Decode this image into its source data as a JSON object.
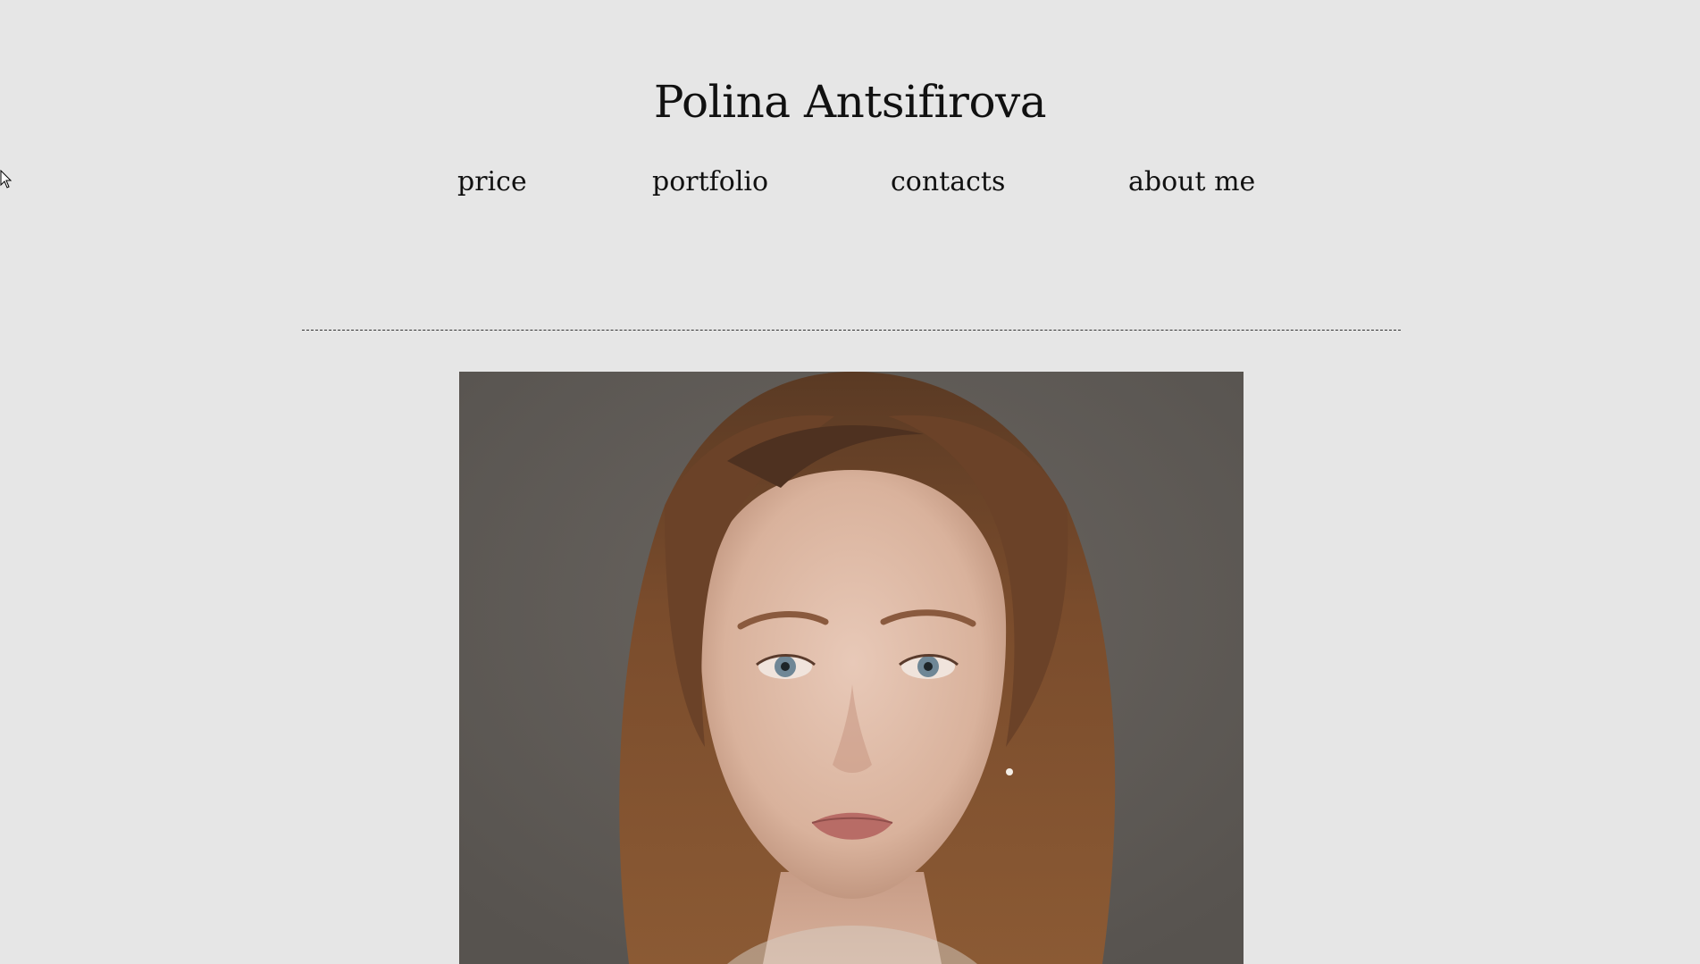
{
  "header": {
    "site_title": "Polina Antsifirova"
  },
  "nav": {
    "items": [
      {
        "label": "price"
      },
      {
        "label": "portfolio"
      },
      {
        "label": "contacts"
      },
      {
        "label": "about me"
      }
    ]
  },
  "hero_photo": {
    "subject": "portrait-photo"
  },
  "colors": {
    "page_background": "#e6e6e6",
    "text": "#111111",
    "photo_background": "#5e5a55"
  }
}
